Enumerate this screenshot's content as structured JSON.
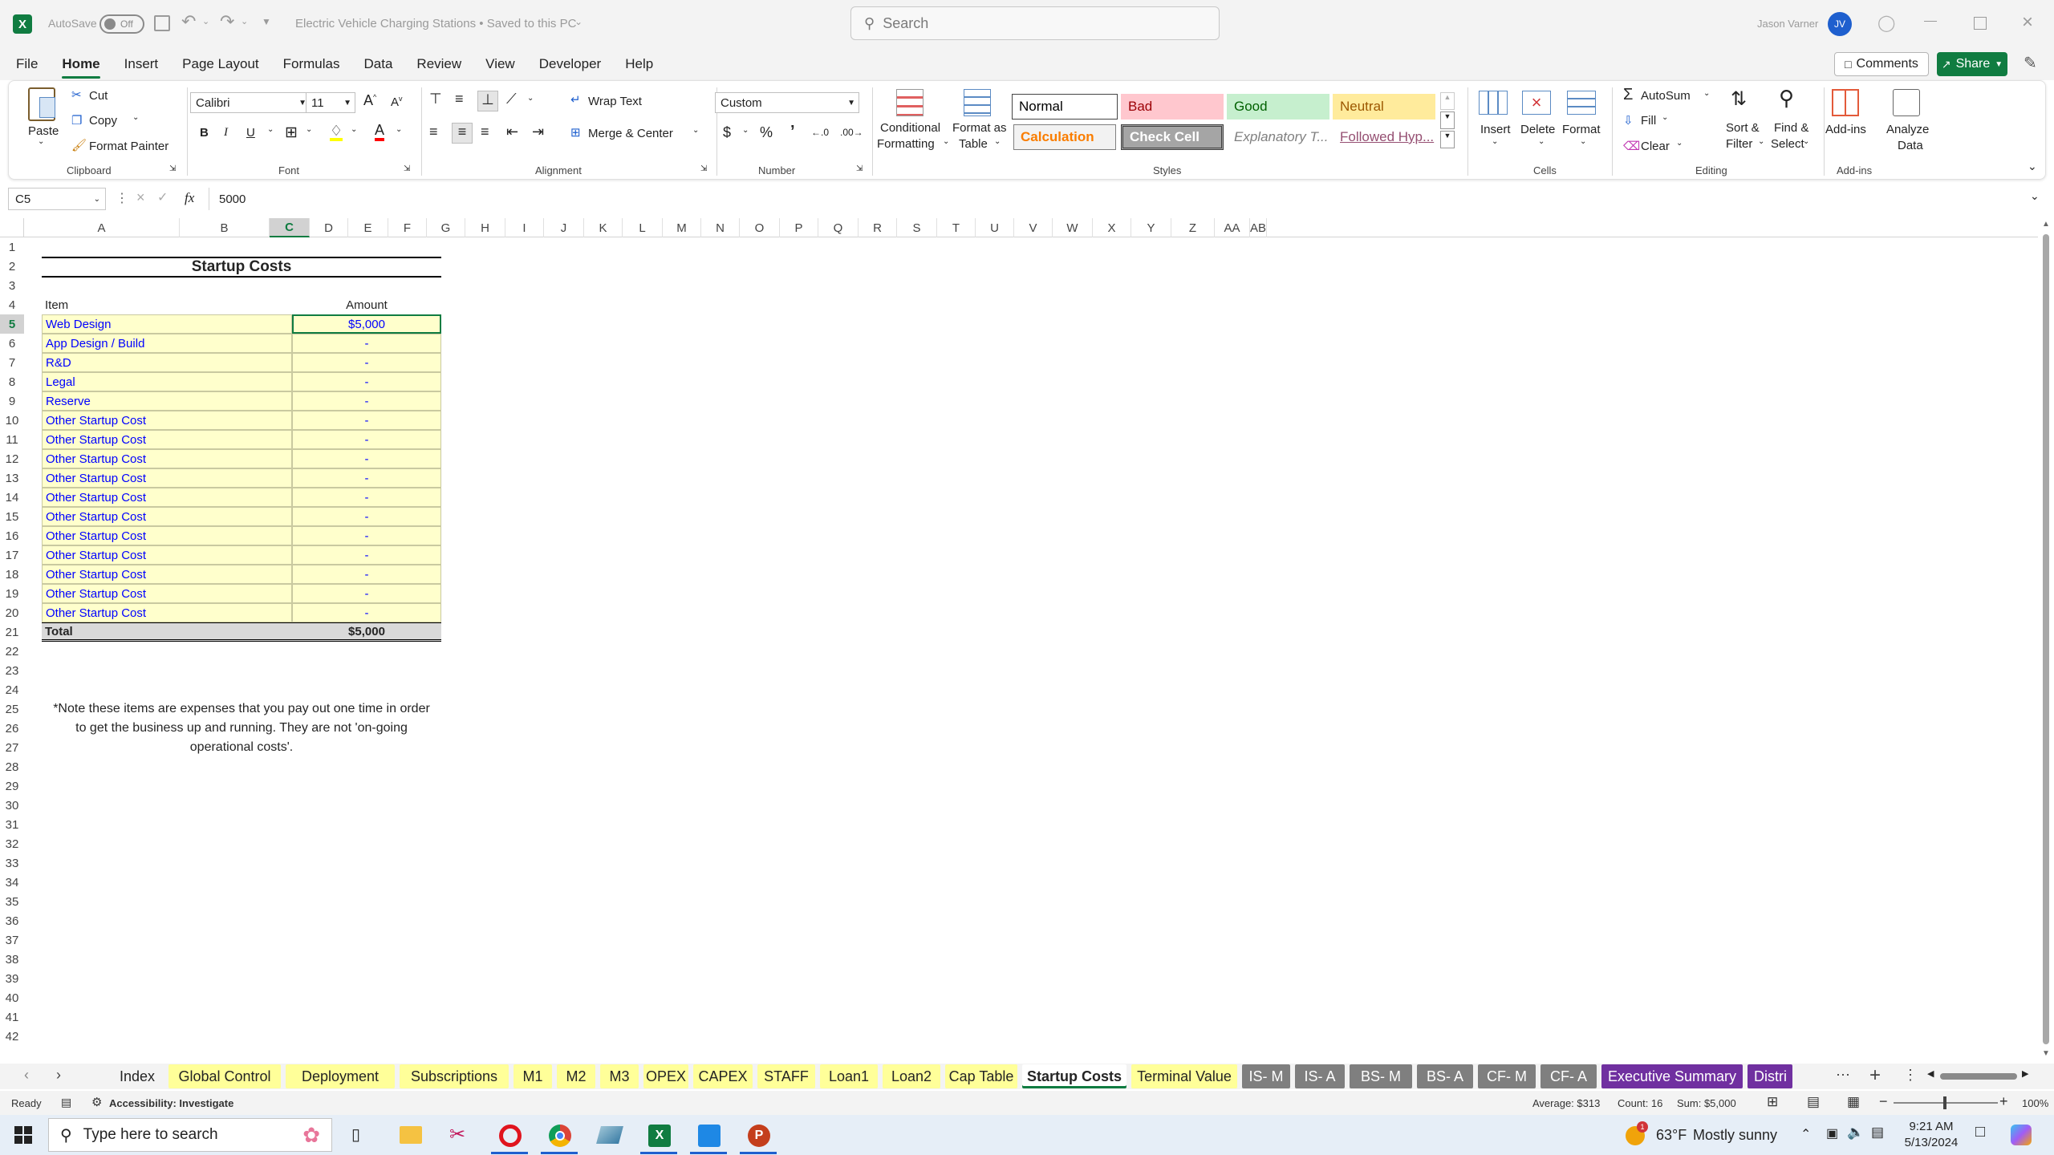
{
  "titlebar": {
    "autosave_label": "AutoSave",
    "autosave_state": "Off",
    "doc_title": "Electric Vehicle Charging Stations • Saved to this PC",
    "search_placeholder": "Search",
    "user_name": "Jason Varner",
    "user_initials": "JV"
  },
  "menu": [
    "File",
    "Home",
    "Insert",
    "Page Layout",
    "Formulas",
    "Data",
    "Review",
    "View",
    "Developer",
    "Help"
  ],
  "menu_active": "Home",
  "comments_label": "Comments",
  "share_label": "Share",
  "ribbon": {
    "clipboard": {
      "paste": "Paste",
      "cut": "Cut",
      "copy": "Copy",
      "format_painter": "Format Painter",
      "group": "Clipboard"
    },
    "font": {
      "name": "Calibri",
      "size": "11",
      "group": "Font"
    },
    "alignment": {
      "wrap": "Wrap Text",
      "merge": "Merge & Center",
      "group": "Alignment"
    },
    "number": {
      "format": "Custom",
      "group": "Number"
    },
    "styles": {
      "cond_fmt_1": "Conditional",
      "cond_fmt_2": "Formatting",
      "fmt_table_1": "Format as",
      "fmt_table_2": "Table",
      "normal": "Normal",
      "bad": "Bad",
      "good": "Good",
      "neutral": "Neutral",
      "calculation": "Calculation",
      "check_cell": "Check Cell",
      "explanatory": "Explanatory T...",
      "followed_hyp": "Followed Hyp...",
      "group": "Styles"
    },
    "cells": {
      "insert": "Insert",
      "delete": "Delete",
      "format": "Format",
      "group": "Cells"
    },
    "editing": {
      "autosum": "AutoSum",
      "fill": "Fill",
      "clear": "Clear",
      "sort_1": "Sort &",
      "sort_2": "Filter",
      "find_1": "Find &",
      "find_2": "Select",
      "group": "Editing"
    },
    "addins": {
      "addins": "Add-ins",
      "analyze_1": "Analyze",
      "analyze_2": "Data",
      "group": "Add-ins"
    }
  },
  "formula_bar": {
    "name_box": "C5",
    "fx": "fx",
    "value": "5000"
  },
  "columns": [
    "A",
    "B",
    "C",
    "D",
    "E",
    "F",
    "G",
    "H",
    "I",
    "J",
    "K",
    "L",
    "M",
    "N",
    "O",
    "P",
    "Q",
    "R",
    "S",
    "T",
    "U",
    "V",
    "W",
    "X",
    "Y",
    "Z",
    "AA",
    "AB"
  ],
  "rows": [
    "1",
    "2",
    "3",
    "4",
    "5",
    "6",
    "7",
    "8",
    "9",
    "10",
    "11",
    "12",
    "13",
    "14",
    "15",
    "16",
    "17",
    "18",
    "19",
    "20",
    "21",
    "22",
    "23",
    "24",
    "25",
    "26",
    "27",
    "28",
    "29",
    "30",
    "31",
    "32",
    "33",
    "34",
    "35",
    "36",
    "37",
    "38",
    "39",
    "40",
    "41",
    "42"
  ],
  "sheet": {
    "title": "Startup Costs",
    "header_item": "Item",
    "header_amount": "Amount",
    "items": [
      {
        "name": "Web Design",
        "amount": "$5,000"
      },
      {
        "name": "App Design / Build",
        "amount": "-"
      },
      {
        "name": "R&D",
        "amount": "-"
      },
      {
        "name": "Legal",
        "amount": "-"
      },
      {
        "name": "Reserve",
        "amount": "-"
      },
      {
        "name": "Other Startup Cost",
        "amount": "-"
      },
      {
        "name": "Other Startup Cost",
        "amount": "-"
      },
      {
        "name": "Other Startup Cost",
        "amount": "-"
      },
      {
        "name": "Other Startup Cost",
        "amount": "-"
      },
      {
        "name": "Other Startup Cost",
        "amount": "-"
      },
      {
        "name": "Other Startup Cost",
        "amount": "-"
      },
      {
        "name": "Other Startup Cost",
        "amount": "-"
      },
      {
        "name": "Other Startup Cost",
        "amount": "-"
      },
      {
        "name": "Other Startup Cost",
        "amount": "-"
      },
      {
        "name": "Other Startup Cost",
        "amount": "-"
      },
      {
        "name": "Other Startup Cost",
        "amount": "-"
      }
    ],
    "total_label": "Total",
    "total_amount": "$5,000",
    "note_line1": "*Note these items are expenses that you pay out one time in order",
    "note_line2": "to get the business up and running. They are not 'on-going",
    "note_line3": "operational costs'."
  },
  "tabs": [
    {
      "label": "Index",
      "style": "plain"
    },
    {
      "label": "Global Control",
      "style": "yellow"
    },
    {
      "label": "Deployment",
      "style": "yellow"
    },
    {
      "label": "Subscriptions",
      "style": "yellow"
    },
    {
      "label": "M1",
      "style": "yellow"
    },
    {
      "label": "M2",
      "style": "yellow"
    },
    {
      "label": "M3",
      "style": "yellow"
    },
    {
      "label": "OPEX",
      "style": "yellow"
    },
    {
      "label": "CAPEX",
      "style": "yellow"
    },
    {
      "label": "STAFF",
      "style": "yellow"
    },
    {
      "label": "Loan1",
      "style": "yellow"
    },
    {
      "label": "Loan2",
      "style": "yellow"
    },
    {
      "label": "Cap Table",
      "style": "yellow"
    },
    {
      "label": "Startup Costs",
      "style": "active"
    },
    {
      "label": "Terminal Value",
      "style": "yellow"
    },
    {
      "label": "IS- M",
      "style": "gray"
    },
    {
      "label": "IS- A",
      "style": "gray"
    },
    {
      "label": "BS- M",
      "style": "gray"
    },
    {
      "label": "BS- A",
      "style": "gray"
    },
    {
      "label": "CF- M",
      "style": "gray"
    },
    {
      "label": "CF- A",
      "style": "gray"
    },
    {
      "label": "Executive Summary",
      "style": "purple"
    },
    {
      "label": "Distri",
      "style": "purple"
    }
  ],
  "status": {
    "ready": "Ready",
    "accessibility": "Accessibility: Investigate",
    "average": "Average: $313",
    "count": "Count: 16",
    "sum": "Sum: $5,000",
    "zoom": "100%"
  },
  "taskbar": {
    "search_placeholder": "Type here to search",
    "weather_temp": "63°F",
    "weather_desc": "Mostly sunny",
    "time": "9:21 AM",
    "date": "5/13/2024",
    "notification_count": "1"
  },
  "colors": {
    "excel_green": "#107c41",
    "input_yellow": "#ffffcc",
    "input_blue": "#0000ff",
    "tab_yellow": "#ffff99",
    "tab_gray": "#7f7f7f",
    "tab_purple": "#7030a0"
  }
}
